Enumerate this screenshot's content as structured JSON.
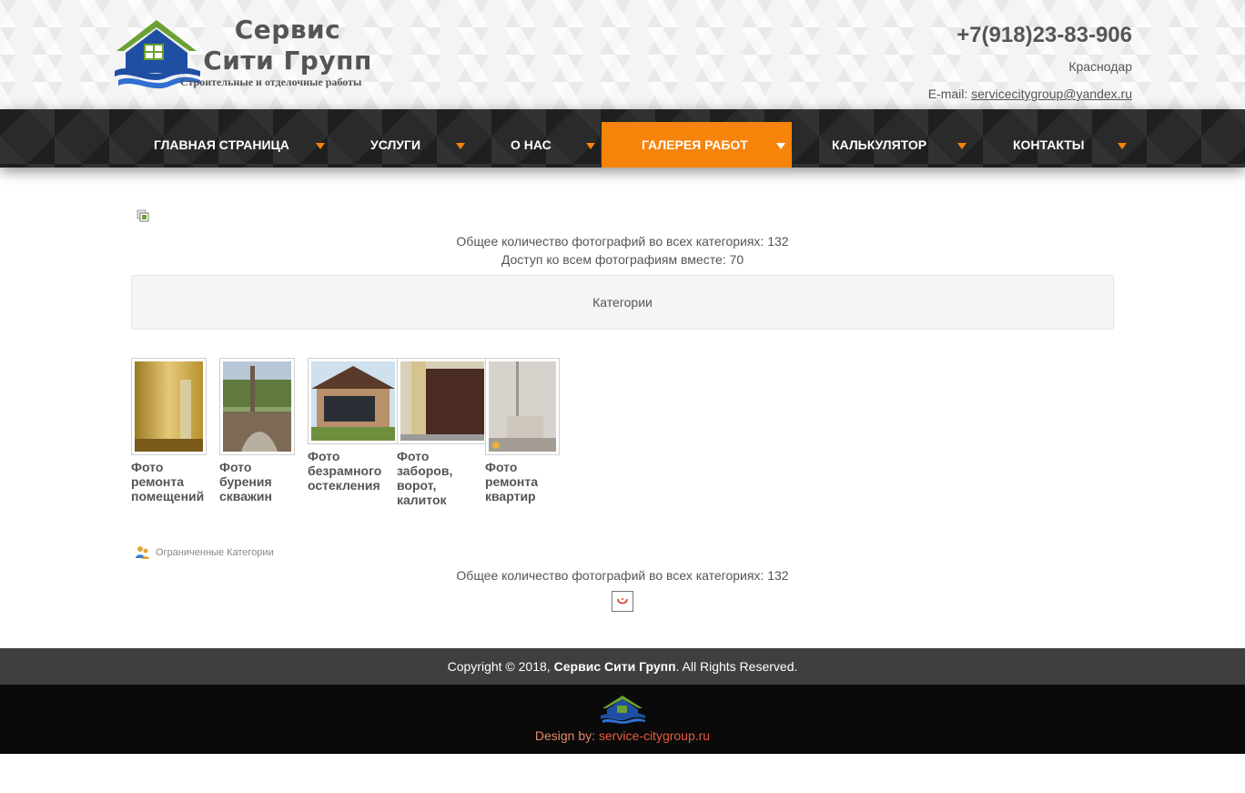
{
  "header": {
    "logo_title_line1": "Сервис",
    "logo_title_line2": "Сити Групп",
    "logo_tagline": "Строительные и отделочные работы",
    "phone": "+7(918)23-83-906",
    "city": "Краснодар",
    "email_label": "E-mail:",
    "email": "servicecitygroup@yandex.ru"
  },
  "nav": {
    "items": [
      {
        "label": "ГЛАВНАЯ СТРАНИЦА"
      },
      {
        "label": "УСЛУГИ"
      },
      {
        "label": "О НАС"
      },
      {
        "label": "ГАЛЕРЕЯ РАБОТ",
        "active": true
      },
      {
        "label": "КАЛЬКУЛЯТОР"
      },
      {
        "label": "КОНТАКТЫ"
      }
    ]
  },
  "gallery": {
    "total_photos": "Общее количество фотографий во всех категориях: 132",
    "access_all": "Доступ ко всем фотографиям вместе: 70",
    "categories_label": "Категории",
    "items": [
      {
        "line1": "Фото",
        "line2": "ремонта",
        "line3": "помещений"
      },
      {
        "line1": "Фото",
        "line2": "бурения",
        "line3": "скважин"
      },
      {
        "line1": "Фото",
        "line2": "безрамного",
        "line3": "остекления"
      },
      {
        "line1": "Фото",
        "line2": "заборов,",
        "line3": "ворот,",
        "line4": "калиток"
      },
      {
        "line1": "Фото",
        "line2": "ремонта",
        "line3": "квартир"
      }
    ],
    "restricted_label": "Ограниченные Категории",
    "total_photos_bottom": "Общее количество фотографий во всех категориях: 132"
  },
  "footer": {
    "copyright_prefix": "Copyright © 2018,",
    "company": "Сервис Сити Групп",
    "copyright_suffix": ". All Rights Reserved.",
    "design_by_label": "Design by:",
    "design_by_link": "service-citygroup.ru"
  },
  "colors": {
    "accent": "#f7840a",
    "nav_bg": "#2a2a2a",
    "footer_top": "#3f3f3f",
    "footer_bottom": "#0a0a0a",
    "design_link": "#e85a3a"
  }
}
